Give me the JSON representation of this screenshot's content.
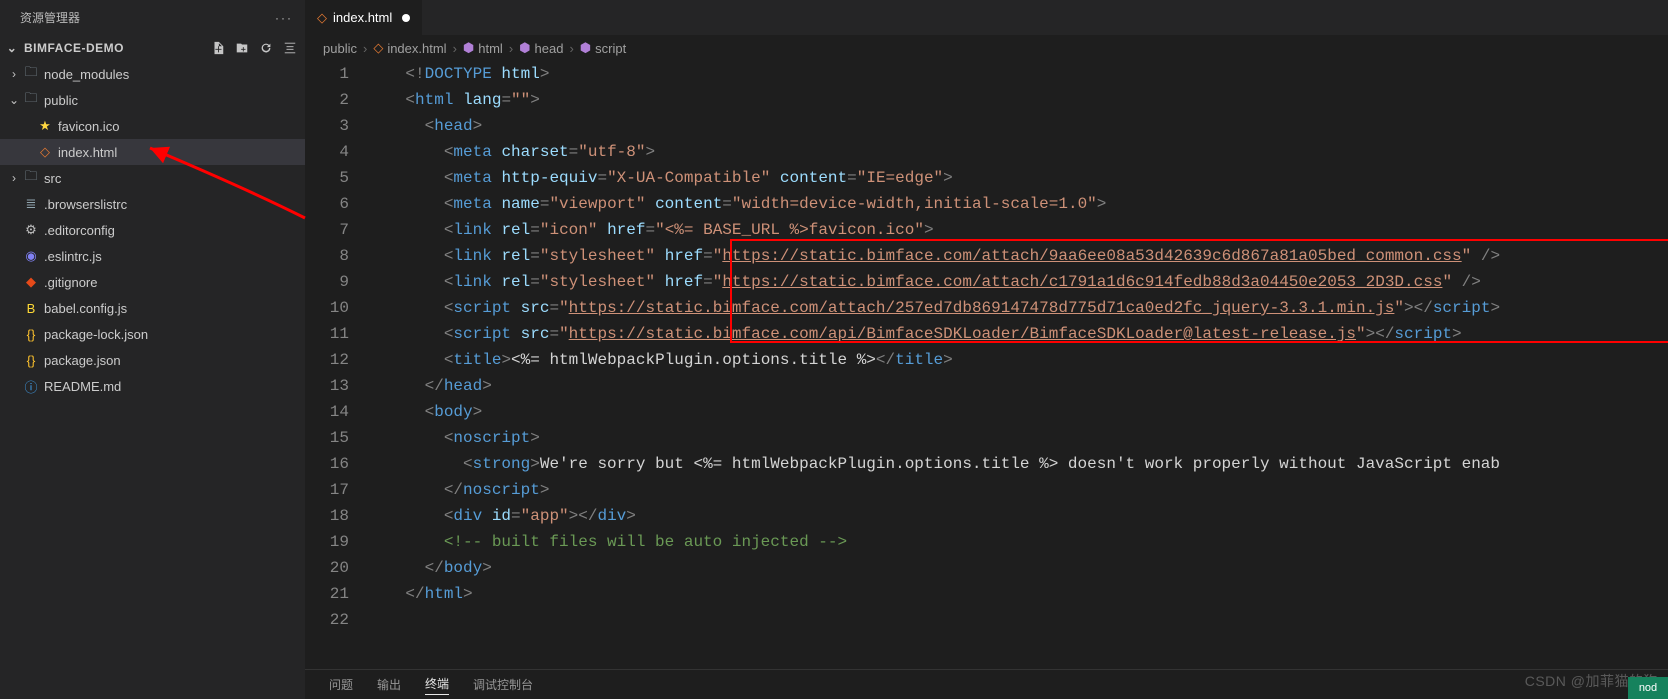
{
  "explorer": {
    "title": "资源管理器",
    "project_name": "BIMFACE-DEMO",
    "actions": {
      "new_file": "new-file",
      "new_folder": "new-folder",
      "refresh": "refresh",
      "collapse": "collapse"
    },
    "tree": [
      {
        "depth": 0,
        "type": "folder",
        "expanded": false,
        "label": "node_modules",
        "icon": "folder-icon",
        "color": "#90a4ae"
      },
      {
        "depth": 0,
        "type": "folder",
        "expanded": true,
        "label": "public",
        "icon": "folder-icon",
        "color": "#90a4ae"
      },
      {
        "depth": 1,
        "type": "file",
        "label": "favicon.ico",
        "icon": "star-icon",
        "color": "#ffd740"
      },
      {
        "depth": 1,
        "type": "file",
        "label": "index.html",
        "icon": "html-icon",
        "color": "#e37933",
        "selected": true
      },
      {
        "depth": 0,
        "type": "folder",
        "expanded": false,
        "label": "src",
        "icon": "folder-icon",
        "color": "#90a4ae"
      },
      {
        "depth": 0,
        "type": "file",
        "label": ".browserslistrc",
        "icon": "config-icon",
        "color": "#90a4ae"
      },
      {
        "depth": 0,
        "type": "file",
        "label": ".editorconfig",
        "icon": "gear-icon",
        "color": "#bfbfbf"
      },
      {
        "depth": 0,
        "type": "file",
        "label": ".eslintrc.js",
        "icon": "eslint-icon",
        "color": "#8080f2"
      },
      {
        "depth": 0,
        "type": "file",
        "label": ".gitignore",
        "icon": "git-icon",
        "color": "#e64a19"
      },
      {
        "depth": 0,
        "type": "file",
        "label": "babel.config.js",
        "icon": "babel-icon",
        "color": "#fdd835"
      },
      {
        "depth": 0,
        "type": "file",
        "label": "package-lock.json",
        "icon": "json-icon",
        "color": "#fbc02d"
      },
      {
        "depth": 0,
        "type": "file",
        "label": "package.json",
        "icon": "json-icon",
        "color": "#fbc02d"
      },
      {
        "depth": 0,
        "type": "file",
        "label": "README.md",
        "icon": "info-icon",
        "color": "#42a5f5"
      }
    ]
  },
  "tabs": {
    "active": {
      "label": "index.html",
      "dirty": true,
      "icon": "html-icon"
    }
  },
  "breadcrumbs": [
    {
      "label": "public",
      "icon": ""
    },
    {
      "label": "index.html",
      "icon": "html-icon"
    },
    {
      "label": "html",
      "icon": "cube-icon"
    },
    {
      "label": "head",
      "icon": "cube-icon"
    },
    {
      "label": "script",
      "icon": "cube-icon"
    }
  ],
  "code_lines": [
    {
      "n": 1,
      "tokens": [
        [
          "    ",
          "plain"
        ],
        [
          "<!",
          "punc"
        ],
        [
          "DOCTYPE ",
          "tag"
        ],
        [
          "html",
          "attr"
        ],
        [
          ">",
          "punc"
        ]
      ]
    },
    {
      "n": 2,
      "tokens": [
        [
          "    ",
          "plain"
        ],
        [
          "<",
          "punc"
        ],
        [
          "html ",
          "tag"
        ],
        [
          "lang",
          "attr"
        ],
        [
          "=",
          "punc"
        ],
        [
          "\"\"",
          "str"
        ],
        [
          ">",
          "punc"
        ]
      ]
    },
    {
      "n": 3,
      "tokens": [
        [
          "      ",
          "plain"
        ],
        [
          "<",
          "punc"
        ],
        [
          "head",
          "tag"
        ],
        [
          ">",
          "punc"
        ]
      ]
    },
    {
      "n": 4,
      "tokens": [
        [
          "        ",
          "plain"
        ],
        [
          "<",
          "punc"
        ],
        [
          "meta ",
          "tag"
        ],
        [
          "charset",
          "attr"
        ],
        [
          "=",
          "punc"
        ],
        [
          "\"utf-8\"",
          "str"
        ],
        [
          ">",
          "punc"
        ]
      ]
    },
    {
      "n": 5,
      "tokens": [
        [
          "        ",
          "plain"
        ],
        [
          "<",
          "punc"
        ],
        [
          "meta ",
          "tag"
        ],
        [
          "http-equiv",
          "attr"
        ],
        [
          "=",
          "punc"
        ],
        [
          "\"X-UA-Compatible\"",
          "str"
        ],
        [
          " ",
          "plain"
        ],
        [
          "content",
          "attr"
        ],
        [
          "=",
          "punc"
        ],
        [
          "\"IE=edge\"",
          "str"
        ],
        [
          ">",
          "punc"
        ]
      ]
    },
    {
      "n": 6,
      "tokens": [
        [
          "        ",
          "plain"
        ],
        [
          "<",
          "punc"
        ],
        [
          "meta ",
          "tag"
        ],
        [
          "name",
          "attr"
        ],
        [
          "=",
          "punc"
        ],
        [
          "\"viewport\"",
          "str"
        ],
        [
          " ",
          "plain"
        ],
        [
          "content",
          "attr"
        ],
        [
          "=",
          "punc"
        ],
        [
          "\"width=device-width,initial-scale=1.0\"",
          "str"
        ],
        [
          ">",
          "punc"
        ]
      ]
    },
    {
      "n": 7,
      "tokens": [
        [
          "        ",
          "plain"
        ],
        [
          "<",
          "punc"
        ],
        [
          "link ",
          "tag"
        ],
        [
          "rel",
          "attr"
        ],
        [
          "=",
          "punc"
        ],
        [
          "\"icon\"",
          "str"
        ],
        [
          " ",
          "plain"
        ],
        [
          "href",
          "attr"
        ],
        [
          "=",
          "punc"
        ],
        [
          "\"<%= BASE_URL %>favicon.ico\"",
          "str"
        ],
        [
          ">",
          "punc"
        ]
      ]
    },
    {
      "n": 8,
      "tokens": [
        [
          "        ",
          "plain"
        ],
        [
          "<",
          "punc"
        ],
        [
          "link ",
          "tag"
        ],
        [
          "rel",
          "attr"
        ],
        [
          "=",
          "punc"
        ],
        [
          "\"stylesheet\"",
          "str"
        ],
        [
          " ",
          "plain"
        ],
        [
          "href",
          "attr"
        ],
        [
          "=",
          "punc"
        ],
        [
          "\"",
          "str"
        ],
        [
          "https://static.bimface.com/attach/9aa6ee08a53d42639c6d867a81a05bed_common.css",
          "url"
        ],
        [
          "\"",
          "str"
        ],
        [
          " />",
          "punc"
        ]
      ]
    },
    {
      "n": 9,
      "tokens": [
        [
          "        ",
          "plain"
        ],
        [
          "<",
          "punc"
        ],
        [
          "link ",
          "tag"
        ],
        [
          "rel",
          "attr"
        ],
        [
          "=",
          "punc"
        ],
        [
          "\"stylesheet\"",
          "str"
        ],
        [
          " ",
          "plain"
        ],
        [
          "href",
          "attr"
        ],
        [
          "=",
          "punc"
        ],
        [
          "\"",
          "str"
        ],
        [
          "https://static.bimface.com/attach/c1791a1d6c914fedb88d3a04450e2053_2D3D.css",
          "url"
        ],
        [
          "\"",
          "str"
        ],
        [
          " />",
          "punc"
        ]
      ]
    },
    {
      "n": 10,
      "tokens": [
        [
          "        ",
          "plain"
        ],
        [
          "<",
          "punc"
        ],
        [
          "script ",
          "tag"
        ],
        [
          "src",
          "attr"
        ],
        [
          "=",
          "punc"
        ],
        [
          "\"",
          "str"
        ],
        [
          "https://static.bimface.com/attach/257ed7db869147478d775d71ca0ed2fc_jquery-3.3.1.min.js",
          "url"
        ],
        [
          "\"",
          "str"
        ],
        [
          "></",
          "punc"
        ],
        [
          "script",
          "tag"
        ],
        [
          ">",
          "punc"
        ]
      ]
    },
    {
      "n": 11,
      "tokens": [
        [
          "        ",
          "plain"
        ],
        [
          "<",
          "punc"
        ],
        [
          "script ",
          "tag"
        ],
        [
          "src",
          "attr"
        ],
        [
          "=",
          "punc"
        ],
        [
          "\"",
          "str"
        ],
        [
          "https://static.bimface.com/api/BimfaceSDKLoader/BimfaceSDKLoader@latest-release.js",
          "url"
        ],
        [
          "\"",
          "str"
        ],
        [
          "></",
          "punc"
        ],
        [
          "script",
          "tag"
        ],
        [
          ">",
          "punc"
        ]
      ]
    },
    {
      "n": 12,
      "tokens": [
        [
          "        ",
          "plain"
        ],
        [
          "<",
          "punc"
        ],
        [
          "title",
          "tag"
        ],
        [
          ">",
          "punc"
        ],
        [
          "<%= htmlWebpackPlugin.options.title %>",
          "plain"
        ],
        [
          "</",
          "punc"
        ],
        [
          "title",
          "tag"
        ],
        [
          ">",
          "punc"
        ]
      ]
    },
    {
      "n": 13,
      "tokens": [
        [
          "      ",
          "plain"
        ],
        [
          "</",
          "punc"
        ],
        [
          "head",
          "tag"
        ],
        [
          ">",
          "punc"
        ]
      ]
    },
    {
      "n": 14,
      "tokens": [
        [
          "      ",
          "plain"
        ],
        [
          "<",
          "punc"
        ],
        [
          "body",
          "tag"
        ],
        [
          ">",
          "punc"
        ]
      ]
    },
    {
      "n": 15,
      "tokens": [
        [
          "        ",
          "plain"
        ],
        [
          "<",
          "punc"
        ],
        [
          "noscript",
          "tag"
        ],
        [
          ">",
          "punc"
        ]
      ]
    },
    {
      "n": 16,
      "tokens": [
        [
          "          ",
          "plain"
        ],
        [
          "<",
          "punc"
        ],
        [
          "strong",
          "tag"
        ],
        [
          ">",
          "punc"
        ],
        [
          "We're sorry but <%= htmlWebpackPlugin.options.title %> doesn't work properly without JavaScript enab",
          "plain"
        ]
      ]
    },
    {
      "n": 17,
      "tokens": [
        [
          "        ",
          "plain"
        ],
        [
          "</",
          "punc"
        ],
        [
          "noscript",
          "tag"
        ],
        [
          ">",
          "punc"
        ]
      ]
    },
    {
      "n": 18,
      "tokens": [
        [
          "        ",
          "plain"
        ],
        [
          "<",
          "punc"
        ],
        [
          "div ",
          "tag"
        ],
        [
          "id",
          "attr"
        ],
        [
          "=",
          "punc"
        ],
        [
          "\"app\"",
          "str"
        ],
        [
          "></",
          "punc"
        ],
        [
          "div",
          "tag"
        ],
        [
          ">",
          "punc"
        ]
      ]
    },
    {
      "n": 19,
      "tokens": [
        [
          "        ",
          "plain"
        ],
        [
          "<!-- built files will be auto injected -->",
          "comment"
        ]
      ]
    },
    {
      "n": 20,
      "tokens": [
        [
          "      ",
          "plain"
        ],
        [
          "</",
          "punc"
        ],
        [
          "body",
          "tag"
        ],
        [
          ">",
          "punc"
        ]
      ]
    },
    {
      "n": 21,
      "tokens": [
        [
          "    ",
          "plain"
        ],
        [
          "</",
          "punc"
        ],
        [
          "html",
          "tag"
        ],
        [
          ">",
          "punc"
        ]
      ]
    },
    {
      "n": 22,
      "tokens": [
        [
          "",
          "plain"
        ]
      ]
    }
  ],
  "bottom_panel": {
    "tabs": [
      "问题",
      "输出",
      "终端",
      "调试控制台"
    ],
    "active": "终端"
  },
  "watermark": "CSDN @加菲猫的狗",
  "status_right": "nod"
}
